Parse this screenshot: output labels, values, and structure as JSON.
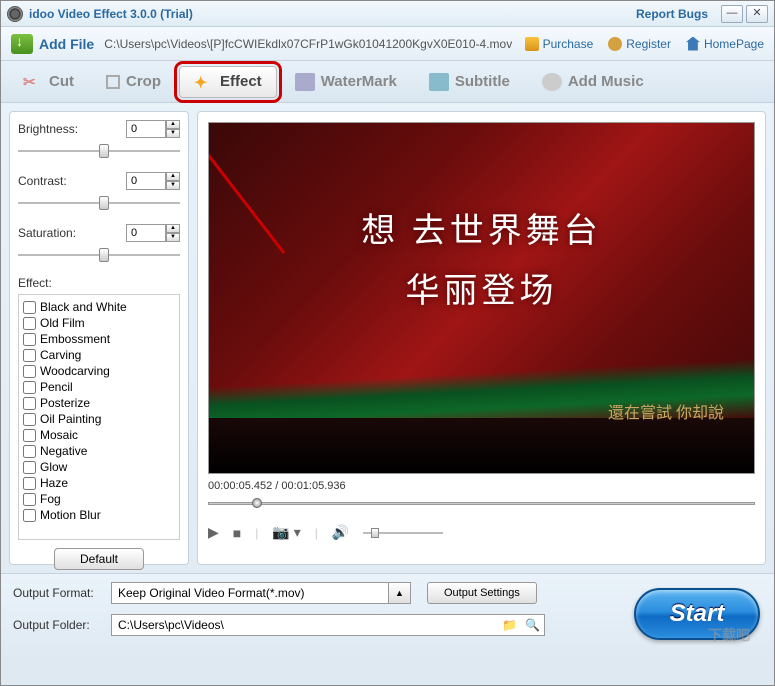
{
  "titlebar": {
    "title": "idoo Video Effect 3.0.0 (Trial)",
    "report": "Report Bugs"
  },
  "topbar": {
    "addfile": "Add File",
    "filepath": "C:\\Users\\pc\\Videos\\[P]fcCWIEkdlx07CFrP1wGk01041200KgvX0E010-4.mov",
    "purchase": "Purchase",
    "register": "Register",
    "homepage": "HomePage"
  },
  "tabs": {
    "cut": "Cut",
    "crop": "Crop",
    "effect": "Effect",
    "watermark": "WaterMark",
    "subtitle": "Subtitle",
    "music": "Add Music"
  },
  "sliders": {
    "brightness": {
      "label": "Brightness:",
      "value": "0"
    },
    "contrast": {
      "label": "Contrast:",
      "value": "0"
    },
    "saturation": {
      "label": "Saturation:",
      "value": "0"
    }
  },
  "effectHeader": "Effect:",
  "effects": [
    "Black and White",
    "Old Film",
    "Embossment",
    "Carving",
    "Woodcarving",
    "Pencil",
    "Posterize",
    "Oil Painting",
    "Mosaic",
    "Negative",
    "Glow",
    "Haze",
    "Fog",
    "Motion Blur"
  ],
  "defaultBtn": "Default",
  "preview": {
    "line1": "想 去世界舞台",
    "line2": "华丽登场",
    "line3": "還在嘗試 你却說"
  },
  "time": "00:00:05.452 / 00:01:05.936",
  "bottom": {
    "formatLabel": "Output Format:",
    "format": "Keep Original Video Format(*.mov)",
    "settings": "Output Settings",
    "folderLabel": "Output Folder:",
    "folder": "C:\\Users\\pc\\Videos\\",
    "start": "Start"
  },
  "watermark": "下载吧"
}
